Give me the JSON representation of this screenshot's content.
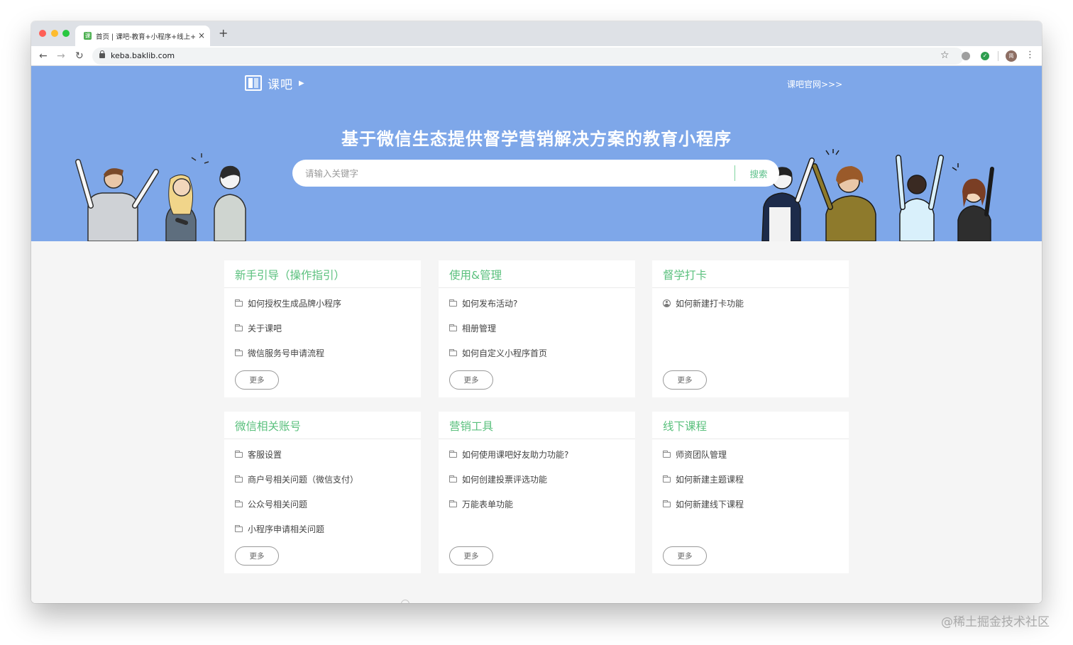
{
  "browser": {
    "tab_title": "首页 | 课吧-教育+小程序+线上+",
    "tab_favicon": "课",
    "url": "keba.baklib.com",
    "profile_initial": "简",
    "buttons": {
      "new_tab": "+",
      "close_tab": "×",
      "back": "←",
      "forward": "→",
      "reload": "↻",
      "bookmark": "☆",
      "menu": "⋮"
    }
  },
  "header": {
    "logo_text": "课吧",
    "logo_arrow": "▶",
    "official_link": "课吧官网>>>"
  },
  "hero": {
    "title": "基于微信生态提供督学营销解决方案的教育小程序",
    "search_placeholder": "请输入关键字",
    "search_button": "搜索"
  },
  "sections": [
    {
      "title": "新手引导（操作指引）",
      "items": [
        {
          "icon": "folder-icon",
          "label": "如何授权生成品牌小程序"
        },
        {
          "icon": "folder-icon",
          "label": "关于课吧"
        },
        {
          "icon": "folder-icon",
          "label": "微信服务号申请流程"
        }
      ],
      "more": "更多"
    },
    {
      "title": "使用&管理",
      "items": [
        {
          "icon": "folder-icon",
          "label": "如何发布活动?"
        },
        {
          "icon": "folder-icon",
          "label": "相册管理"
        },
        {
          "icon": "folder-icon",
          "label": "如何自定义小程序首页"
        }
      ],
      "more": "更多"
    },
    {
      "title": "督学打卡",
      "items": [
        {
          "icon": "user-icon",
          "label": "如何新建打卡功能"
        }
      ],
      "more": "更多"
    },
    {
      "title": "微信相关账号",
      "items": [
        {
          "icon": "folder-icon",
          "label": "客服设置"
        },
        {
          "icon": "folder-icon",
          "label": "商户号相关问题（微信支付）"
        },
        {
          "icon": "folder-icon",
          "label": "公众号相关问题"
        },
        {
          "icon": "folder-icon",
          "label": "小程序申请相关问题"
        }
      ],
      "more": "更多"
    },
    {
      "title": "营销工具",
      "items": [
        {
          "icon": "folder-icon",
          "label": "如何使用课吧好友助力功能?"
        },
        {
          "icon": "folder-icon",
          "label": "如何创建投票评选功能"
        },
        {
          "icon": "folder-icon",
          "label": "万能表单功能"
        }
      ],
      "more": "更多"
    },
    {
      "title": "线下课程",
      "items": [
        {
          "icon": "folder-icon",
          "label": "师资团队管理"
        },
        {
          "icon": "folder-icon",
          "label": "如何新建主题课程"
        },
        {
          "icon": "folder-icon",
          "label": "如何新建线下课程"
        }
      ],
      "more": "更多"
    }
  ],
  "watermark": "@稀土掘金技术社区",
  "colors": {
    "hero_blue": "#7ea7e9",
    "accent_green": "#5ac07d",
    "page_bg": "#f5f5f5"
  }
}
